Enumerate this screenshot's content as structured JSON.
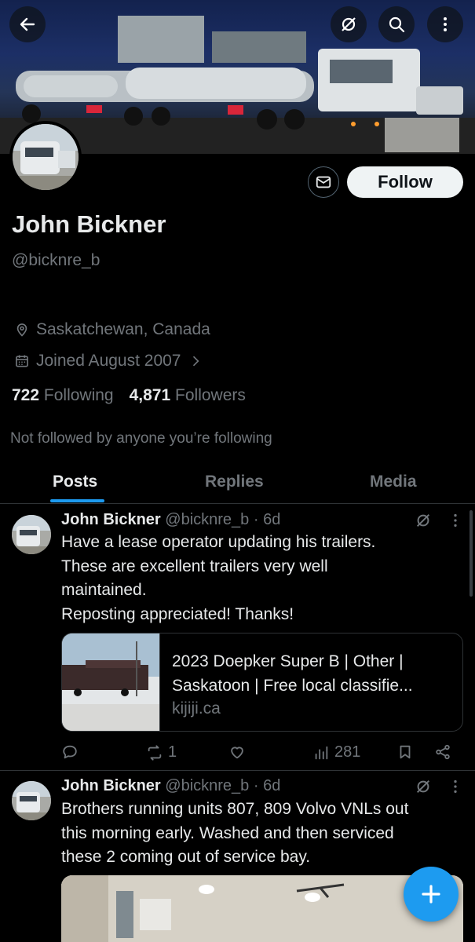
{
  "profile": {
    "name": "John Bickner",
    "handle": "@bicknre_b",
    "location": "Saskatchewan, Canada",
    "joined": "Joined August 2007",
    "following_count": "722",
    "following_label": "Following",
    "followers_count": "4,871",
    "followers_label": "Followers",
    "not_followed_text": "Not followed by anyone you’re following",
    "follow_label": "Follow"
  },
  "tabs": [
    {
      "label": "Posts",
      "active": true
    },
    {
      "label": "Replies",
      "active": false
    },
    {
      "label": "Media",
      "active": false
    }
  ],
  "posts": [
    {
      "author": "John Bickner",
      "handle": "@bicknre_b",
      "time": "· 6d",
      "lines": [
        "Have a lease operator updating his trailers.",
        "These are excellent trailers very well",
        "maintained.",
        "Reposting appreciated!  Thanks!"
      ],
      "card": {
        "title_line1": "2023 Doepker Super B | Other |",
        "title_line2": "Saskatoon | Free local classifie...",
        "domain": "kijiji.ca"
      },
      "reposts": "1",
      "views": "281"
    },
    {
      "author": "John Bickner",
      "handle": "@bicknre_b",
      "time": "· 6d",
      "lines": [
        "Brothers running units 807, 809 Volvo VNLs out",
        "this morning early.   Washed and then serviced",
        "these 2 coming out of service bay."
      ]
    }
  ],
  "icons": {
    "back": "arrow-left-icon",
    "grok": "grok-icon",
    "search": "search-icon",
    "more": "more-vertical-icon",
    "message": "envelope-icon",
    "location": "location-pin-icon",
    "calendar": "calendar-icon",
    "reply": "reply-icon",
    "repost": "repost-icon",
    "like": "heart-icon",
    "views": "views-icon",
    "bookmark": "bookmark-icon",
    "share": "share-icon",
    "compose": "plus-icon"
  },
  "colors": {
    "accent": "#1d9bf0",
    "background": "#000000",
    "text_primary": "#e7e9ea",
    "text_secondary": "#71767b"
  }
}
